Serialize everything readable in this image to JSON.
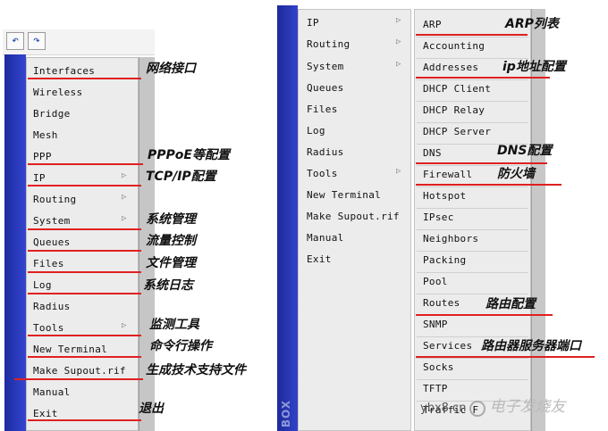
{
  "left_window": {
    "toolbar": {
      "undo_glyph": "↶",
      "redo_glyph": "↷"
    },
    "menu_items": [
      {
        "label": "Interfaces",
        "submenu": false
      },
      {
        "label": "Wireless",
        "submenu": false
      },
      {
        "label": "Bridge",
        "submenu": false
      },
      {
        "label": "Mesh",
        "submenu": false
      },
      {
        "label": "PPP",
        "submenu": false
      },
      {
        "label": "IP",
        "submenu": true
      },
      {
        "label": "Routing",
        "submenu": true
      },
      {
        "label": "System",
        "submenu": true
      },
      {
        "label": "Queues",
        "submenu": false
      },
      {
        "label": "Files",
        "submenu": false
      },
      {
        "label": "Log",
        "submenu": false
      },
      {
        "label": "Radius",
        "submenu": false
      },
      {
        "label": "Tools",
        "submenu": true
      },
      {
        "label": "New Terminal",
        "submenu": false
      },
      {
        "label": "Make Supout.rif",
        "submenu": false
      },
      {
        "label": "Manual",
        "submenu": false
      },
      {
        "label": "Exit",
        "submenu": false
      }
    ],
    "annotations": [
      "网络接口",
      "PPPoE等配置",
      "TCP/IP配置",
      "系统管理",
      "流量控制",
      "文件管理",
      "系统日志",
      "监测工具",
      "命令行操作",
      "生成技术支持文件",
      "退出"
    ]
  },
  "right_window": {
    "sidebar_label": "BOX",
    "main_menu": [
      {
        "label": "IP",
        "submenu": true
      },
      {
        "label": "Routing",
        "submenu": true
      },
      {
        "label": "System",
        "submenu": true
      },
      {
        "label": "Queues",
        "submenu": false
      },
      {
        "label": "Files",
        "submenu": false
      },
      {
        "label": "Log",
        "submenu": false
      },
      {
        "label": "Radius",
        "submenu": false
      },
      {
        "label": "Tools",
        "submenu": true
      },
      {
        "label": "New Terminal",
        "submenu": false
      },
      {
        "label": "Make Supout.rif",
        "submenu": false
      },
      {
        "label": "Manual",
        "submenu": false
      },
      {
        "label": "Exit",
        "submenu": false
      }
    ],
    "ip_submenu": [
      "ARP",
      "Accounting",
      "Addresses",
      "DHCP Client",
      "DHCP Relay",
      "DHCP Server",
      "DNS",
      "Firewall",
      "Hotspot",
      "IPsec",
      "Neighbors",
      "Packing",
      "Pool",
      "Routes",
      "SNMP",
      "Services",
      "Socks",
      "TFTP",
      "Traffic F"
    ],
    "annotations": [
      "ARP列表",
      "ip地址配置",
      "DNS配置",
      "防火墙",
      "路由配置",
      "路由器服务器端口"
    ]
  },
  "arrow_glyph": "▷",
  "watermark": {
    "site": "ybx8.cn",
    "brand": "电子发烧友"
  }
}
